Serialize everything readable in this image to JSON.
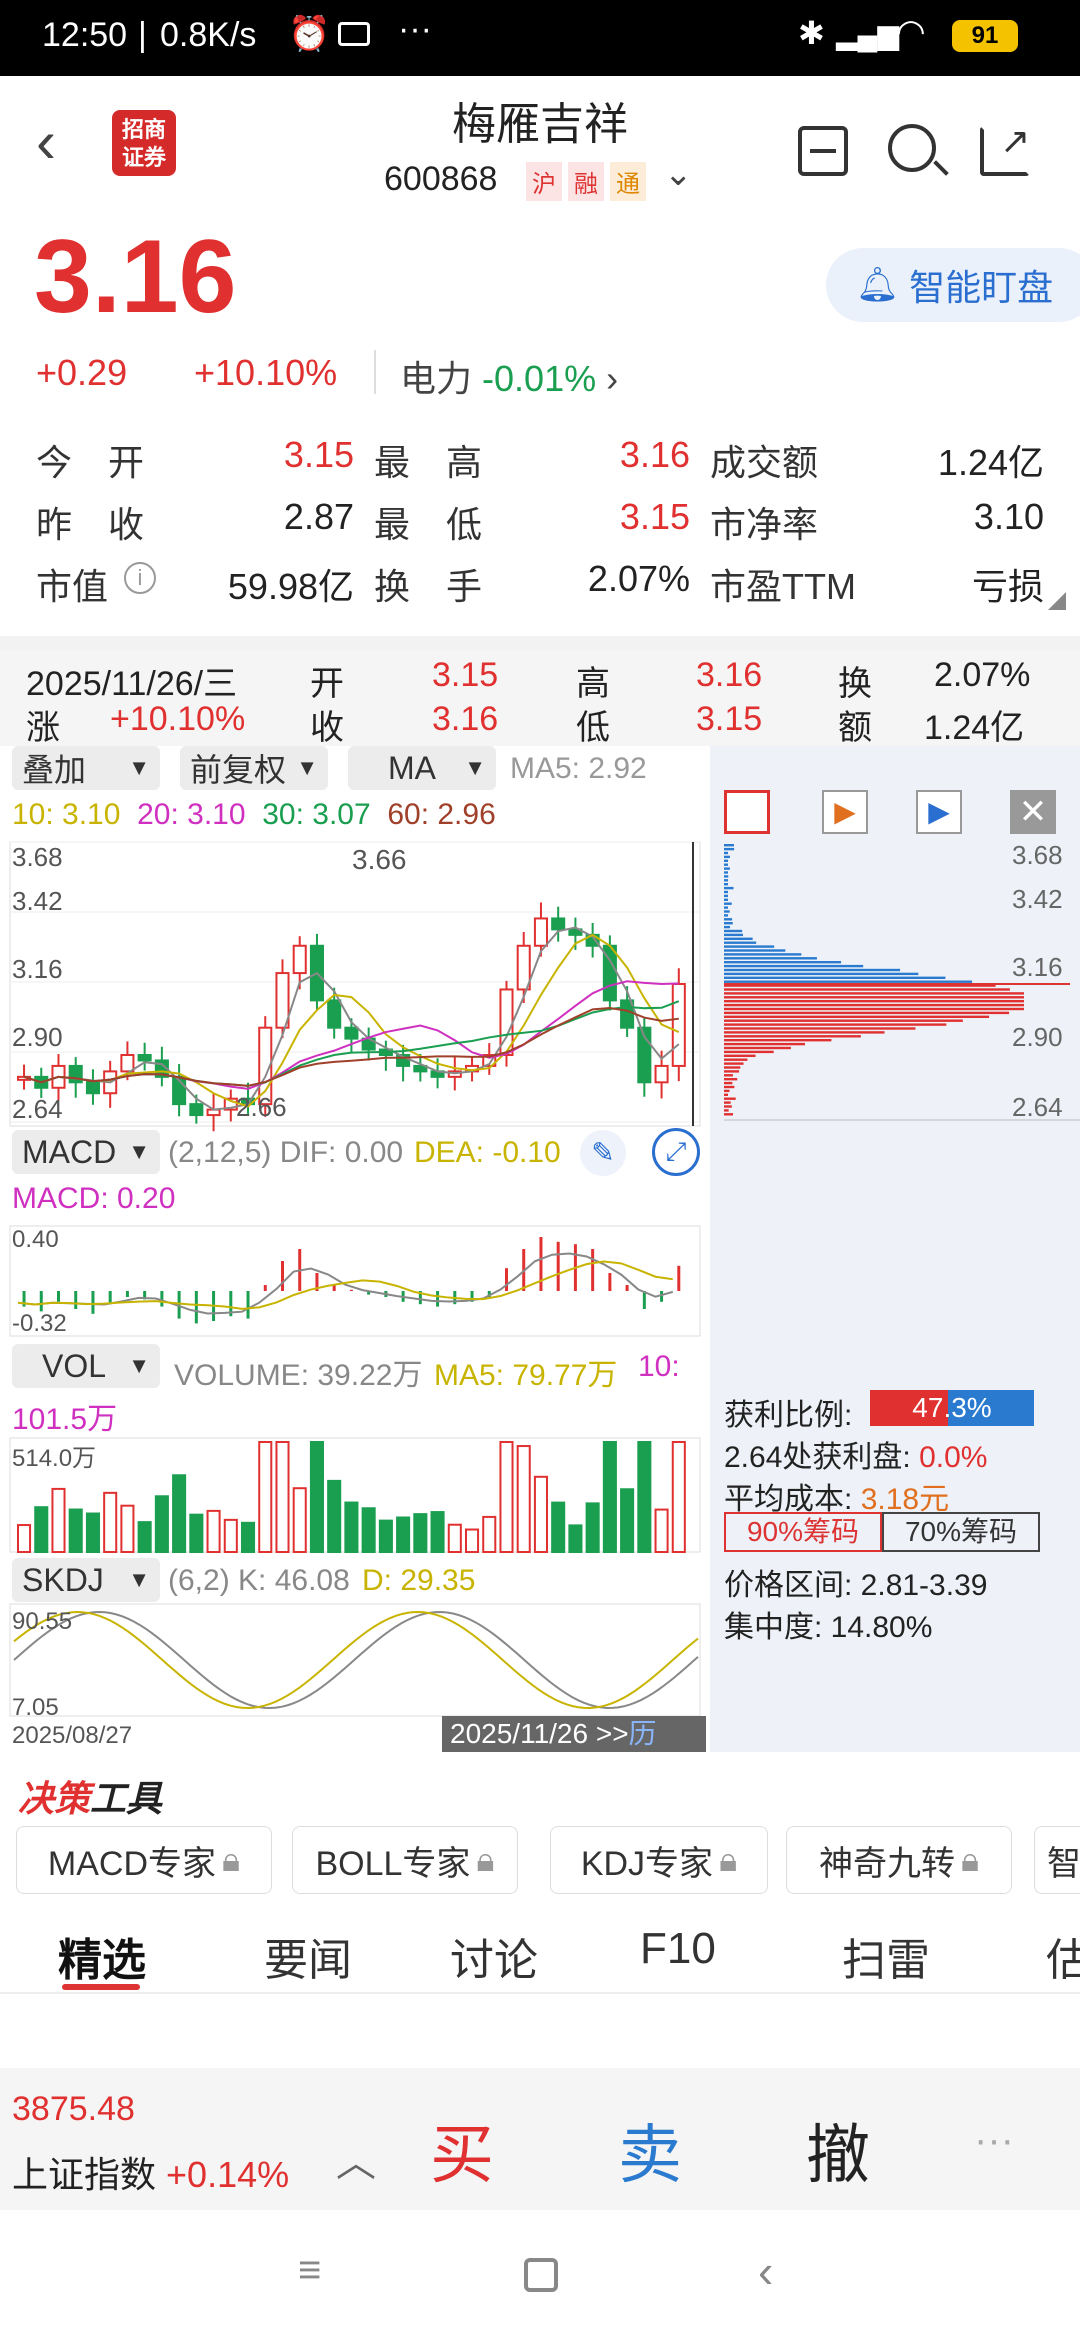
{
  "status_bar": {
    "time": "12:50",
    "speed": "0.8K/s",
    "battery": "91"
  },
  "header": {
    "broker_logo": "招商证券",
    "stock_name": "梅雁吉祥",
    "stock_code": "600868",
    "tags": [
      "沪",
      "融",
      "通"
    ]
  },
  "price": {
    "current": "3.16",
    "change": "+0.29",
    "change_pct": "+10.10%",
    "sector_label": "电力",
    "sector_change": "-0.01%",
    "smart_watch": "智能盯盘"
  },
  "stats": [
    {
      "label": "今　开",
      "value": "3.15"
    },
    {
      "label": "最　高",
      "value": "3.16"
    },
    {
      "label": "成交额",
      "value": "1.24亿"
    },
    {
      "label": "昨　收",
      "value": "2.87"
    },
    {
      "label": "最　低",
      "value": "3.15"
    },
    {
      "label": "市净率",
      "value": "3.10"
    },
    {
      "label": "市值",
      "value": "59.98亿"
    },
    {
      "label": "换　手",
      "value": "2.07%"
    },
    {
      "label": "市盈TTM",
      "value": "亏损"
    }
  ],
  "kline_info": {
    "date": "2025/11/26/三",
    "rise_label": "涨",
    "rise": "+10.10%",
    "open_label": "开",
    "open": "3.15",
    "close_label": "收",
    "close": "3.16",
    "high_label": "高",
    "high": "3.16",
    "low_label": "低",
    "low": "3.15",
    "turnover_label": "换",
    "turnover": "2.07%",
    "amount_label": "额",
    "amount": "1.24亿"
  },
  "toolbar": {
    "overlay": "叠加",
    "adjust": "前复权",
    "ma": "MA",
    "ma5": "MA5: 2.92",
    "ma10": "10: 3.10",
    "ma20": "20: 3.10",
    "ma30": "30: 3.07",
    "ma60": "60: 2.96"
  },
  "main_chart": {
    "y_labels": [
      "3.68",
      "3.42",
      "3.16",
      "2.90",
      "2.64"
    ],
    "peak_label": "3.66",
    "low_label": "2.66"
  },
  "macd": {
    "name": "MACD",
    "params": "(2,12,5) DIF: 0.00",
    "dea": "DEA: -0.10",
    "macd": "MACD: 0.20",
    "top": "0.40",
    "bottom": "-0.32"
  },
  "vol": {
    "name": "VOL",
    "volume": "VOLUME: 39.22万",
    "ma5": "MA5: 79.77万",
    "ma10_a": "10:",
    "ma10_b": "101.5万",
    "top": "514.0万"
  },
  "skdj": {
    "name": "SKDJ",
    "params": "(6,2) K: 46.08",
    "d": "D: 29.35",
    "top": "90.55",
    "bottom": "7.05",
    "start_date": "2025/08/27",
    "end_date": "2025/11/26 >>",
    "hist": "历"
  },
  "chips": {
    "y_labels": [
      "3.68",
      "3.42",
      "3.16",
      "2.90",
      "2.64"
    ],
    "profit_label": "获利比例:",
    "profit_value": "47.3%",
    "profit_fraction": 0.473,
    "profit_at": "2.64处获利盘:",
    "profit_at_value": "0.0%",
    "avg_cost": "平均成本:",
    "avg_cost_value": "3.18元",
    "btn90": "90%筹码",
    "btn70": "70%筹码",
    "range": "价格区间: 2.81-3.39",
    "concentration": "集中度: 14.80%"
  },
  "tools": {
    "title_a": "决策",
    "title_b": "工具",
    "items": [
      "MACD专家",
      "BOLL专家",
      "KDJ专家",
      "神奇九转",
      "智"
    ]
  },
  "tabs": [
    "精选",
    "要闻",
    "讨论",
    "F10",
    "扫雷",
    "估"
  ],
  "index_bar": {
    "value": "3875.48",
    "name": "上证指数",
    "change": "+0.14%",
    "buy": "买",
    "sell": "卖",
    "cancel": "撤"
  },
  "colors": {
    "up": "#e03030",
    "down": "#1a9e50",
    "blue": "#2a7ad0"
  }
}
